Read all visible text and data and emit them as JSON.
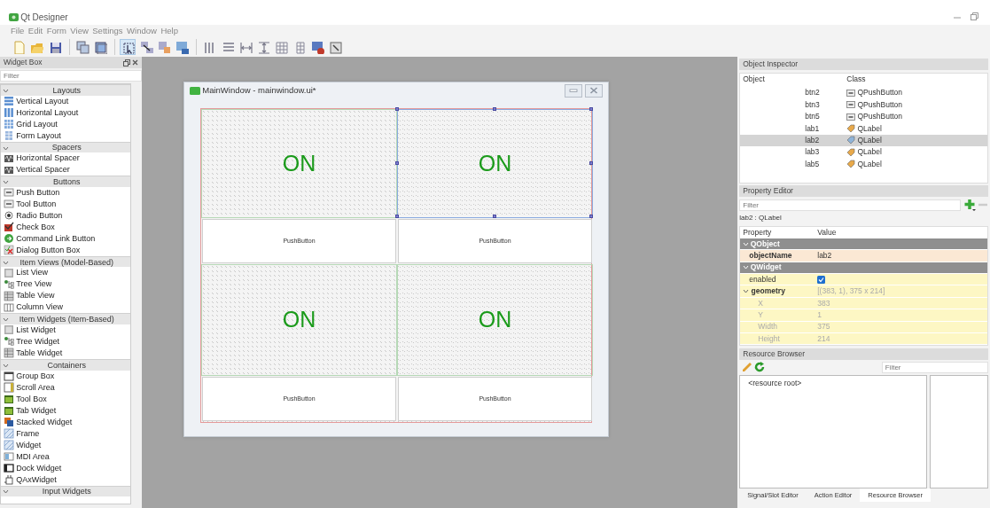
{
  "app": {
    "title": "Qt Designer"
  },
  "menu": [
    "File",
    "Edit",
    "Form",
    "View",
    "Settings",
    "Window",
    "Help"
  ],
  "widget_box": {
    "title": "Widget Box",
    "filter_placeholder": "Filter",
    "categories": [
      {
        "name": "Layouts",
        "expanded": true,
        "items": [
          "Vertical Layout",
          "Horizontal Layout",
          "Grid Layout",
          "Form Layout"
        ]
      },
      {
        "name": "Spacers",
        "expanded": true,
        "items": [
          "Horizontal Spacer",
          "Vertical Spacer"
        ]
      },
      {
        "name": "Buttons",
        "expanded": true,
        "items": [
          "Push Button",
          "Tool Button",
          "Radio Button",
          "Check Box",
          "Command Link Button",
          "Dialog Button Box"
        ]
      },
      {
        "name": "Item Views (Model-Based)",
        "expanded": true,
        "items": [
          "List View",
          "Tree View",
          "Table View",
          "Column View"
        ]
      },
      {
        "name": "Item Widgets (Item-Based)",
        "expanded": true,
        "items": [
          "List Widget",
          "Tree Widget",
          "Table Widget"
        ]
      },
      {
        "name": "Containers",
        "expanded": true,
        "items": [
          "Group Box",
          "Scroll Area",
          "Tool Box",
          "Tab Widget",
          "Stacked Widget",
          "Frame",
          "Widget",
          "MDI Area",
          "Dock Widget",
          "QAxWidget"
        ]
      },
      {
        "name": "Input Widgets",
        "expanded": true
      }
    ]
  },
  "form_window": {
    "title": "MainWindow - mainwindow.ui*",
    "widgets": [
      {
        "kind": "label",
        "text": "ON",
        "selected": false
      },
      {
        "kind": "label",
        "text": "ON",
        "selected": true
      },
      {
        "kind": "button",
        "text": "PushButton",
        "selected": false
      },
      {
        "kind": "button",
        "text": "PushButton",
        "selected": false
      },
      {
        "kind": "label",
        "text": "ON",
        "selected": false
      },
      {
        "kind": "label",
        "text": "ON",
        "selected": false
      },
      {
        "kind": "button",
        "text": "PushButton",
        "selected": false
      },
      {
        "kind": "button",
        "text": "PushButton",
        "selected": false
      }
    ]
  },
  "object_inspector": {
    "title": "Object Inspector",
    "columns": [
      "Object",
      "Class"
    ],
    "rows": [
      {
        "object": "btn2",
        "class": "QPushButton",
        "kind": "button",
        "selected": false
      },
      {
        "object": "btn3",
        "class": "QPushButton",
        "kind": "button",
        "selected": false
      },
      {
        "object": "btn5",
        "class": "QPushButton",
        "kind": "button",
        "selected": false
      },
      {
        "object": "lab1",
        "class": "QLabel",
        "kind": "label",
        "selected": false
      },
      {
        "object": "lab2",
        "class": "QLabel",
        "kind": "label",
        "selected": true
      },
      {
        "object": "lab3",
        "class": "QLabel",
        "kind": "label",
        "selected": false
      },
      {
        "object": "lab5",
        "class": "QLabel",
        "kind": "label",
        "selected": false
      }
    ]
  },
  "property_editor": {
    "title": "Property Editor",
    "filter_placeholder": "Filter",
    "subject": "lab2 : QLabel",
    "columns": [
      "Property",
      "Value"
    ],
    "rows": [
      {
        "kind": "group",
        "name": "QObject",
        "expanded": true
      },
      {
        "kind": "property",
        "name": "objectName",
        "value": "lab2",
        "modified": true
      },
      {
        "kind": "group",
        "name": "QWidget",
        "expanded": true
      },
      {
        "kind": "checkbox",
        "name": "enabled",
        "checked": true,
        "modified": false
      },
      {
        "kind": "property",
        "name": "geometry",
        "value": "[(383, 1), 375 x 214]",
        "modified": true,
        "expanded": true,
        "children": [
          {
            "name": "X",
            "value": "383"
          },
          {
            "name": "Y",
            "value": "1"
          },
          {
            "name": "Width",
            "value": "375"
          },
          {
            "name": "Height",
            "value": "214"
          }
        ]
      }
    ]
  },
  "resource_browser": {
    "title": "Resource Browser",
    "filter_placeholder": "Filter",
    "tree": [
      "<resource root>"
    ]
  },
  "bottom_tabs": [
    {
      "label": "Signal/Slot Editor",
      "selected": false
    },
    {
      "label": "Action Editor",
      "selected": false
    },
    {
      "label": "Resource Browser",
      "selected": true
    }
  ]
}
